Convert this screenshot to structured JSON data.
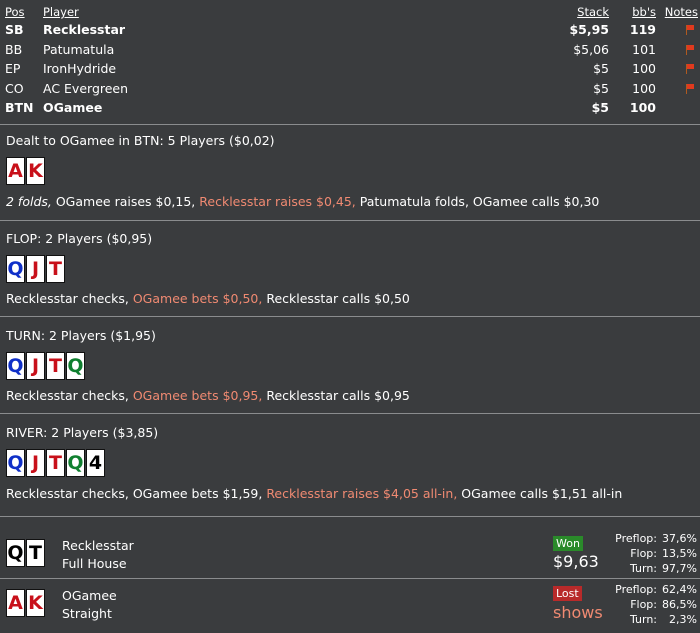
{
  "table_header": {
    "pos": "Pos",
    "player": "Player",
    "stack": "Stack",
    "bb": "bb's",
    "notes": "Notes"
  },
  "players": [
    {
      "pos": "SB",
      "name": "Recklesstar",
      "stack": "$5,95",
      "bb": "119",
      "bold": true,
      "flag": true
    },
    {
      "pos": "BB",
      "name": "Patumatula",
      "stack": "$5,06",
      "bb": "101",
      "bold": false,
      "flag": true
    },
    {
      "pos": "EP",
      "name": "IronHydride",
      "stack": "$5",
      "bb": "100",
      "bold": false,
      "flag": true
    },
    {
      "pos": "CO",
      "name": "AC Evergreen",
      "stack": "$5",
      "bb": "100",
      "bold": false,
      "flag": true
    },
    {
      "pos": "BTN",
      "name": "OGamee",
      "stack": "$5",
      "bb": "100",
      "bold": true,
      "flag": false
    }
  ],
  "preflop": {
    "title": "Dealt to OGamee in BTN: 5 Players ($0,02)",
    "cards": [
      {
        "rank": "A",
        "color": "red"
      },
      {
        "rank": "K",
        "color": "red"
      }
    ],
    "actions": [
      {
        "text": "2 folds,",
        "style": "it"
      },
      {
        "text": " OGamee raises $0,15, ",
        "style": ""
      },
      {
        "text": "Recklesstar raises $0,45,",
        "style": "hl"
      },
      {
        "text": " Patumatula folds, OGamee calls $0,30",
        "style": ""
      }
    ]
  },
  "flop": {
    "title": "FLOP: 2 Players ($0,95)",
    "cards": [
      {
        "rank": "Q",
        "color": "blue"
      },
      {
        "rank": "J",
        "color": "red"
      },
      {
        "rank": "T",
        "color": "red"
      }
    ],
    "actions": [
      {
        "text": "Recklesstar checks, ",
        "style": ""
      },
      {
        "text": "OGamee bets $0,50,",
        "style": "hl"
      },
      {
        "text": " Recklesstar calls $0,50",
        "style": ""
      }
    ]
  },
  "turn": {
    "title": "TURN: 2 Players ($1,95)",
    "cards": [
      {
        "rank": "Q",
        "color": "blue"
      },
      {
        "rank": "J",
        "color": "red"
      },
      {
        "rank": "T",
        "color": "red"
      },
      {
        "rank": "Q",
        "color": "green"
      }
    ],
    "actions": [
      {
        "text": "Recklesstar checks, ",
        "style": ""
      },
      {
        "text": "OGamee bets $0,95,",
        "style": "hl"
      },
      {
        "text": " Recklesstar calls $0,95",
        "style": ""
      }
    ]
  },
  "river": {
    "title": "RIVER: 2 Players ($3,85)",
    "cards": [
      {
        "rank": "Q",
        "color": "blue"
      },
      {
        "rank": "J",
        "color": "red"
      },
      {
        "rank": "T",
        "color": "red"
      },
      {
        "rank": "Q",
        "color": "green"
      },
      {
        "rank": "4",
        "color": "black"
      }
    ],
    "actions": [
      {
        "text": "Recklesstar checks, OGamee bets $1,59, ",
        "style": ""
      },
      {
        "text": "Recklesstar raises $4,05 all-in,",
        "style": "hl"
      },
      {
        "text": " OGamee calls $1,51 all-in",
        "style": ""
      }
    ]
  },
  "results": [
    {
      "name": "Recklesstar",
      "hand": "Full House",
      "cards": [
        {
          "rank": "Q",
          "color": "black"
        },
        {
          "rank": "T",
          "color": "black"
        }
      ],
      "status": "Won",
      "status_type": "won",
      "amount": "$9,63",
      "equity": [
        {
          "label": "Preflop:",
          "value": "37,6%"
        },
        {
          "label": "Flop:",
          "value": "13,5%"
        },
        {
          "label": "Turn:",
          "value": "97,7%"
        }
      ]
    },
    {
      "name": "OGamee",
      "hand": "Straight",
      "cards": [
        {
          "rank": "A",
          "color": "red"
        },
        {
          "rank": "K",
          "color": "red"
        }
      ],
      "status": "Lost",
      "status_type": "lost",
      "amount": "shows",
      "equity": [
        {
          "label": "Preflop:",
          "value": "62,4%"
        },
        {
          "label": "Flop:",
          "value": "86,5%"
        },
        {
          "label": "Turn:",
          "value": "2,3%"
        }
      ]
    }
  ],
  "colors": {
    "background": "#3a3c3e",
    "highlight": "#f08a72",
    "won": "#2a8a2a",
    "lost": "#b82a2a",
    "flag": "#e03a1e"
  }
}
